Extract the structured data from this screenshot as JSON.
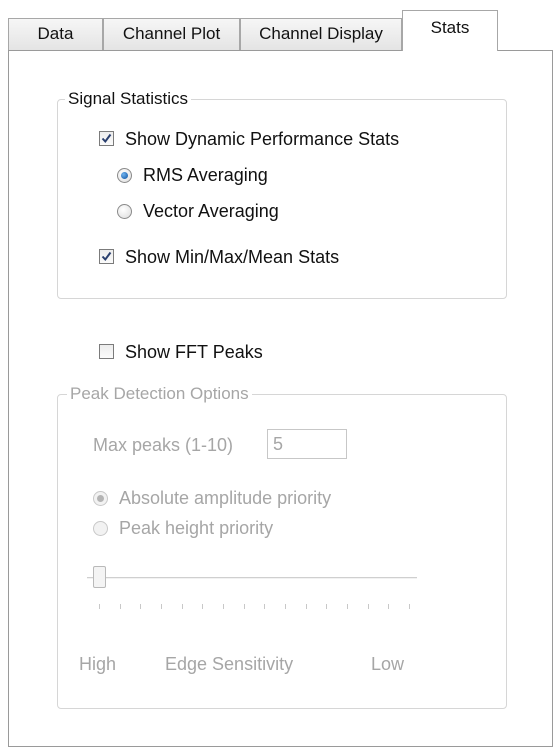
{
  "tabs": [
    {
      "label": "Data"
    },
    {
      "label": "Channel Plot"
    },
    {
      "label": "Channel Display"
    },
    {
      "label": "Stats"
    }
  ],
  "signal_statistics": {
    "title": "Signal Statistics",
    "show_dynamic": {
      "label": "Show Dynamic Performance Stats",
      "checked": true
    },
    "rms": {
      "label": "RMS Averaging",
      "selected": true
    },
    "vector": {
      "label": "Vector Averaging",
      "selected": false
    },
    "show_minmax": {
      "label": "Show Min/Max/Mean Stats",
      "checked": true
    }
  },
  "fft_peaks": {
    "label": "Show FFT Peaks",
    "checked": false
  },
  "peak_detection": {
    "title": "Peak Detection Options",
    "max_peaks_label": "Max peaks (1-10)",
    "max_peaks_value": "5",
    "absolute": {
      "label": "Absolute amplitude priority",
      "selected": true
    },
    "height": {
      "label": "Peak height priority",
      "selected": false
    },
    "slider": {
      "value": 0,
      "min": 0,
      "max": 15
    },
    "high_label": "High",
    "edge_label": "Edge Sensitivity",
    "low_label": "Low"
  }
}
